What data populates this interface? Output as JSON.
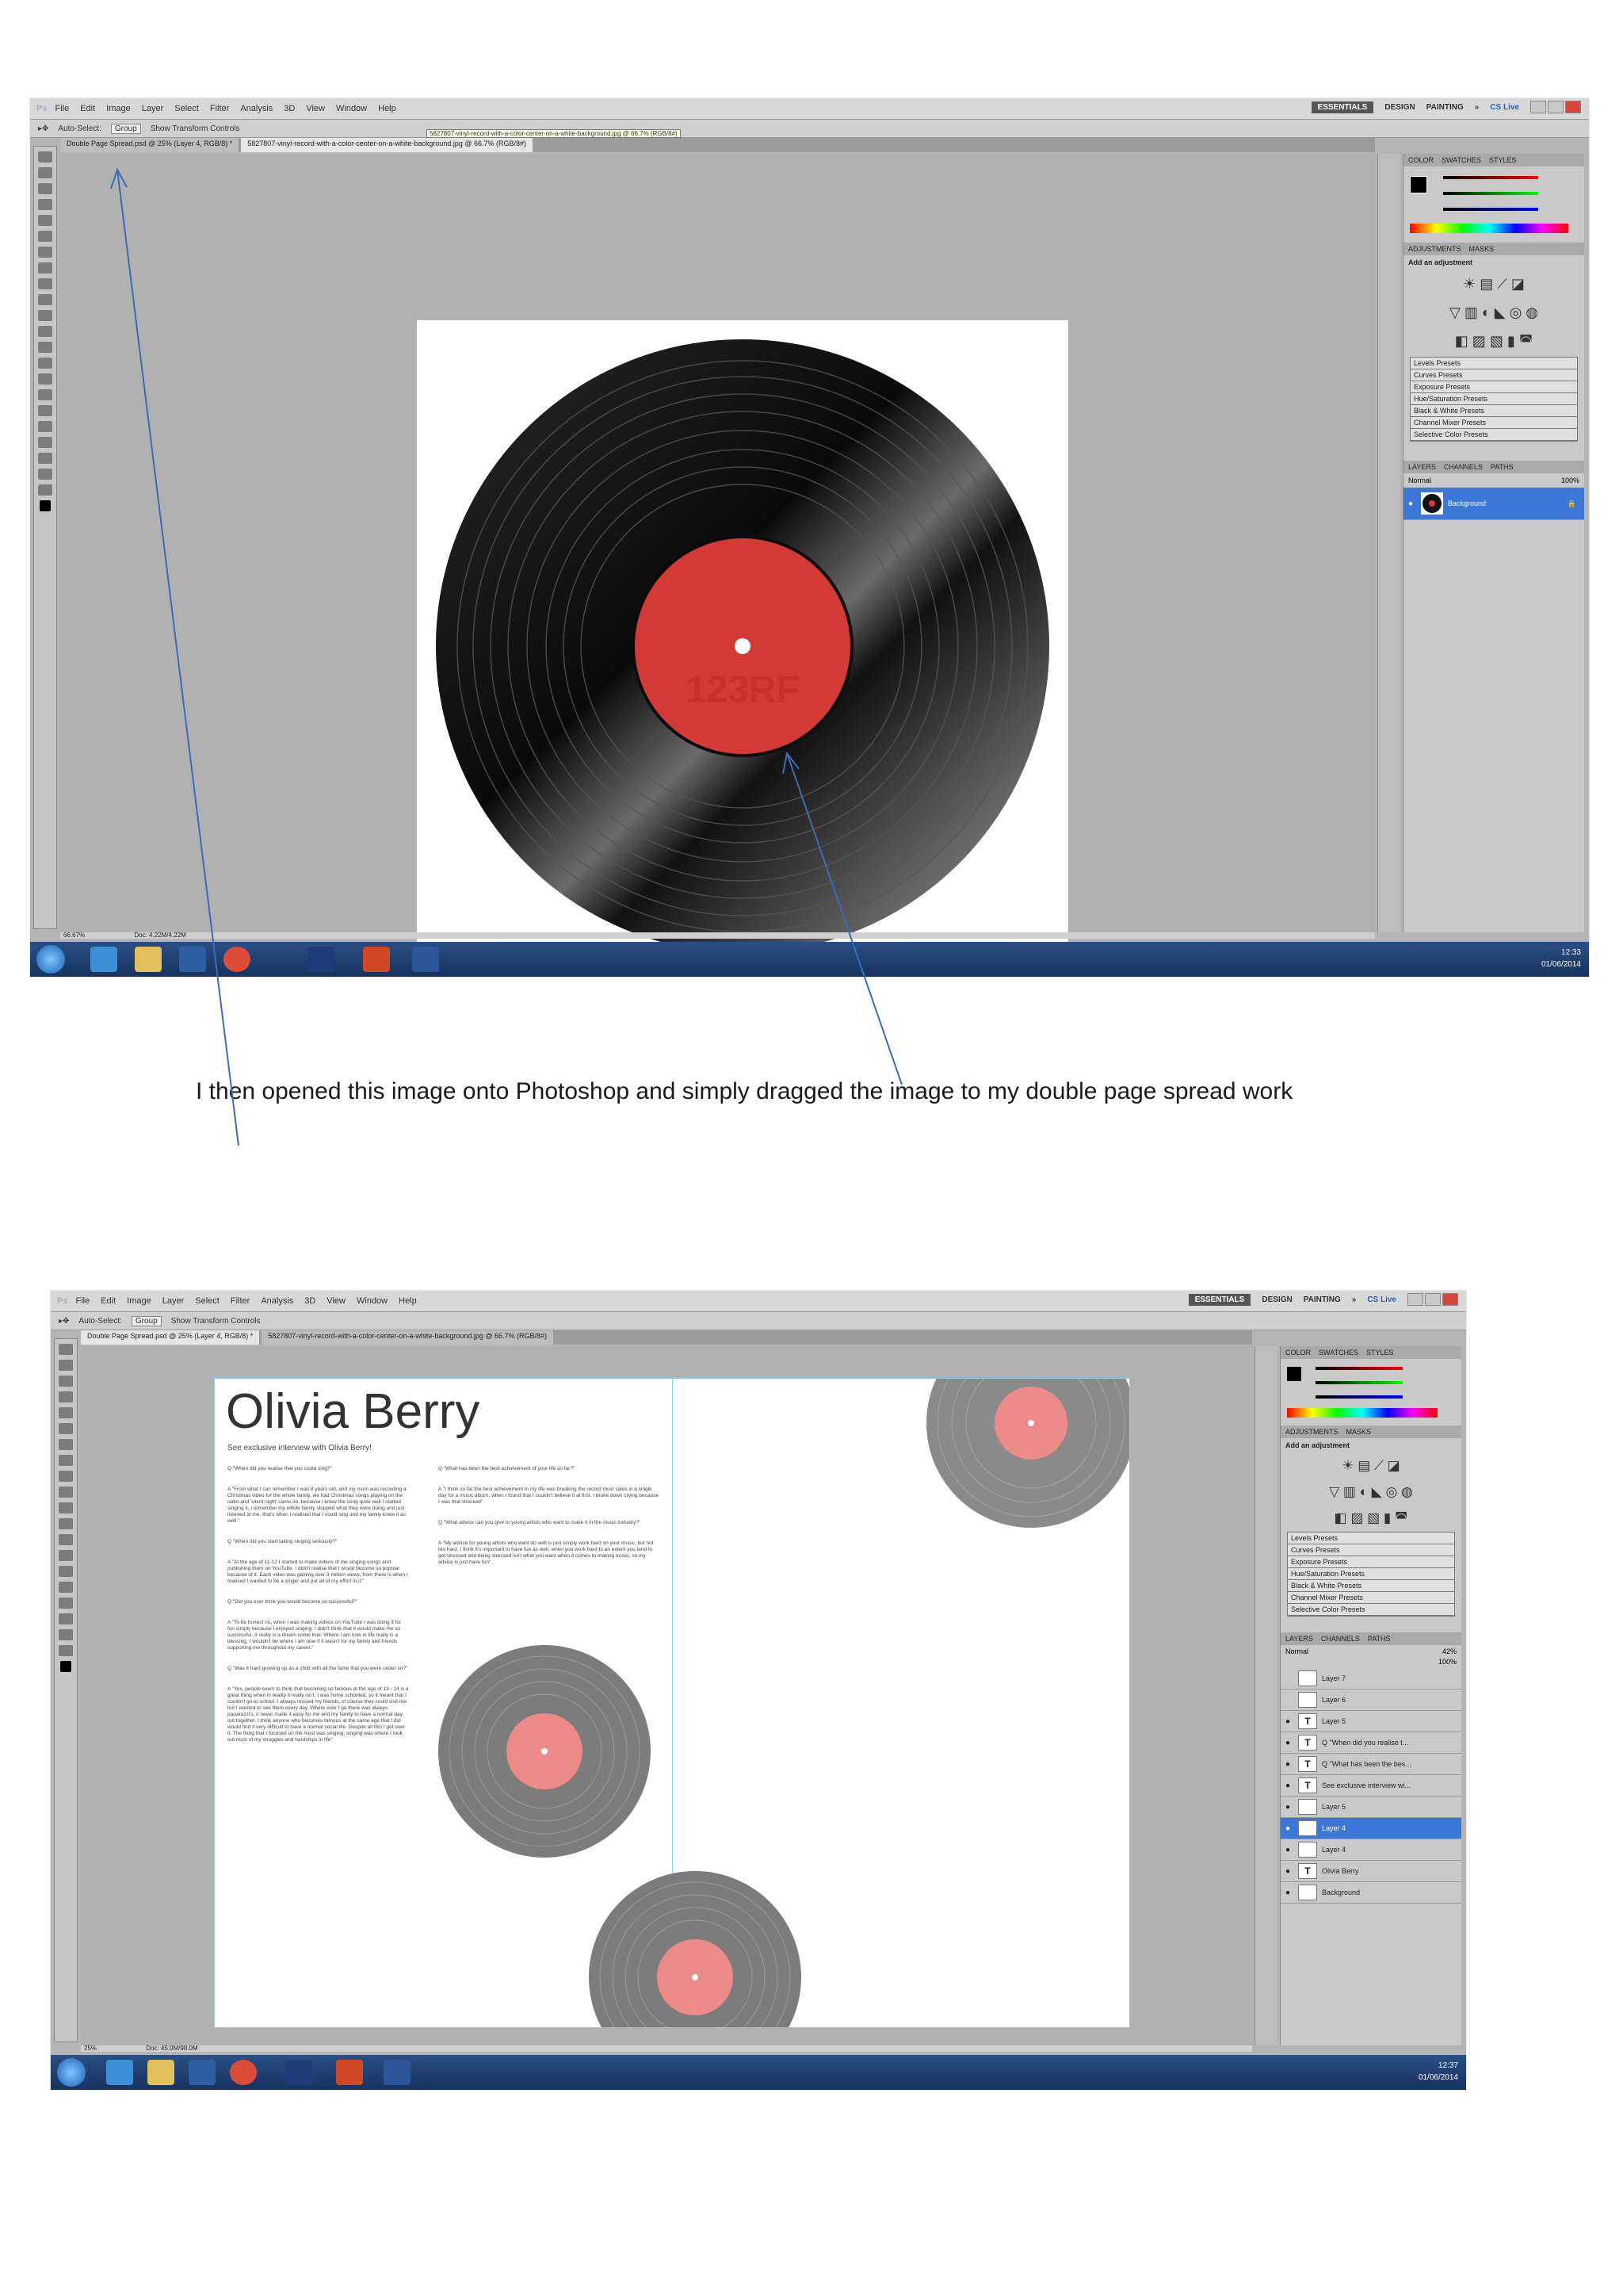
{
  "caption": "I then opened this image onto Photoshop and simply dragged the image to my double page spread work",
  "ps": {
    "logo": "Ps",
    "menu": [
      "File",
      "Edit",
      "Image",
      "Layer",
      "Select",
      "Filter",
      "Analysis",
      "3D",
      "View",
      "Window",
      "Help"
    ],
    "workspaces": [
      "ESSENTIALS",
      "DESIGN",
      "PAINTING",
      "»"
    ],
    "cslive": "CS Live"
  },
  "shot1": {
    "options": [
      "Auto-Select:",
      "Group",
      "Show Transform Controls"
    ],
    "tabs": [
      "Double Page Spread.psd @ 25% (Layer 4, RGB/8) *",
      "5827807-vinyl-record-with-a-color-center-on-a-white-background.jpg @ 66.7% (RGB/8#)"
    ],
    "tooltip": "5827807-vinyl-record-with-a-color-center-on-a-white-background.jpg @ 66.7% (RGB/8#)",
    "label_watermark": "123RF",
    "status": [
      "66.67%",
      "Doc: 4.22M/4.22M"
    ],
    "panels": {
      "color_tabs": [
        "COLOR",
        "SWATCHES",
        "STYLES"
      ],
      "adjust_tabs": [
        "ADJUSTMENTS",
        "MASKS"
      ],
      "add_adjustment": "Add an adjustment",
      "presets": [
        "Levels Presets",
        "Curves Presets",
        "Exposure Presets",
        "Hue/Saturation Presets",
        "Black & White Presets",
        "Channel Mixer Presets",
        "Selective Color Presets"
      ],
      "layers_tabs": [
        "LAYERS",
        "CHANNELS",
        "PATHS"
      ],
      "blend": "Normal",
      "opacity": "100%",
      "layer_name": "Background"
    },
    "clock": [
      "12:33",
      "01/06/2014"
    ]
  },
  "shot2": {
    "options": [
      "Auto-Select:",
      "Group",
      "Show Transform Controls"
    ],
    "tabs": [
      "Double Page Spread.psd @ 25% (Layer 4, RGB/8) *",
      "5827807-vinyl-record-with-a-color-center-on-a-white-background.jpg @ 66.7% (RGB/8#)"
    ],
    "status": [
      "25%",
      "Doc: 45.0M/98.0M"
    ],
    "spread": {
      "title": "Olivia Berry",
      "subtitle": "See exclusive interview with Olivia Berry!",
      "col1": [
        "Q \"When did you realise that you could sing?\"",
        "A \"From what I can remember I was 8 years old, and my mum was recording a Christmas video for the whole family, we had Christmas songs playing on the radio and 'silent night' came on, because I knew the song quite well I started singing it, I remember my whole family stopped what they were doing and just listened to me, that's when I realised that I could sing and my family knew it as well.\"",
        "Q \"When did you start taking singing seriously?\"",
        "A \"At the age of 11-12 I started to make videos of me singing songs and publishing them on YouTube. I didn't realise that I would become so popular because of it. Each video was gaining over 3 million views, from there is when I realised I wanted to be a singer and put all of my effort in it.\"",
        "Q \"Did you ever think you would become so successful?\"",
        "A \"To be honest no, when I was making videos on YouTube I was doing it for fun simply because I enjoyed singing. I didn't think that it would make me so successful. It really is a dream come true. Where I am now in life really is a blessing, I wouldn't be where I am now if it wasn't for my family and friends supporting me throughout my career.\"",
        "Q \"Was it hard growing up as a child with all the fame that you were under so?\"",
        "A \"Yes, people seem to think that becoming so famous at the age of 13 - 14 is a great thing when in reality it really isn't. I was home schooled, so it meant that I couldn't go to school. I always missed my friends, of course they could visit me but I wanted to see them every day. Where ever I go there was always paparazzi's, it never made it easy for me and my family to have a normal day out together. I think anyone who becomes famous at the same age that I did would find it very difficult to have a normal social life. Despite all this I got over it. The thing that I focused on the most was singing, singing was where I took out most of my struggles and hardships in life\""
      ],
      "col2": [
        "Q \"What has been the best achievement of your life so far?\"",
        "A \"I think so far the best achievement in my life was breaking the record most sales in a single day for a music album, when I found that I couldn't believe it at first, I broke down crying because I was that shocked\"",
        "Q \"What advice can you give to young artists who want to make it in the music industry?\"",
        "A \"My advice for young artists who want do well is just simply work hard on your music, but not too hard, I think it's important to have fun as well, when you work hard to an extent you tend to get stressed and being stressed isn't what you want when it comes to making music, so my advice is just have fun\""
      ]
    },
    "panels": {
      "blend": "Normal",
      "opacity": "42%",
      "fill": "100%",
      "layers": [
        {
          "type": "img",
          "name": "Layer 7",
          "vis": false
        },
        {
          "type": "img",
          "name": "Layer 6",
          "vis": false
        },
        {
          "type": "T",
          "name": "Layer 5",
          "vis": true
        },
        {
          "type": "T",
          "name": "Q \"When did you realise t...",
          "vis": true
        },
        {
          "type": "T",
          "name": "Q \"What has been the bes...",
          "vis": true
        },
        {
          "type": "T",
          "name": "See exclusive interview wi...",
          "vis": true
        },
        {
          "type": "img",
          "name": "Layer 5",
          "vis": true
        },
        {
          "type": "img",
          "name": "Layer 4",
          "vis": true,
          "selected": true
        },
        {
          "type": "img",
          "name": "Layer 4",
          "vis": true
        },
        {
          "type": "T",
          "name": "Olivia Berry",
          "vis": true
        },
        {
          "type": "img",
          "name": "Background",
          "vis": true
        }
      ]
    },
    "clock": [
      "12:37",
      "01/06/2014"
    ]
  },
  "colors": {
    "label_red": "#d33a36",
    "label_pink": "#ec8a88",
    "select_blue": "#3b78d8"
  }
}
